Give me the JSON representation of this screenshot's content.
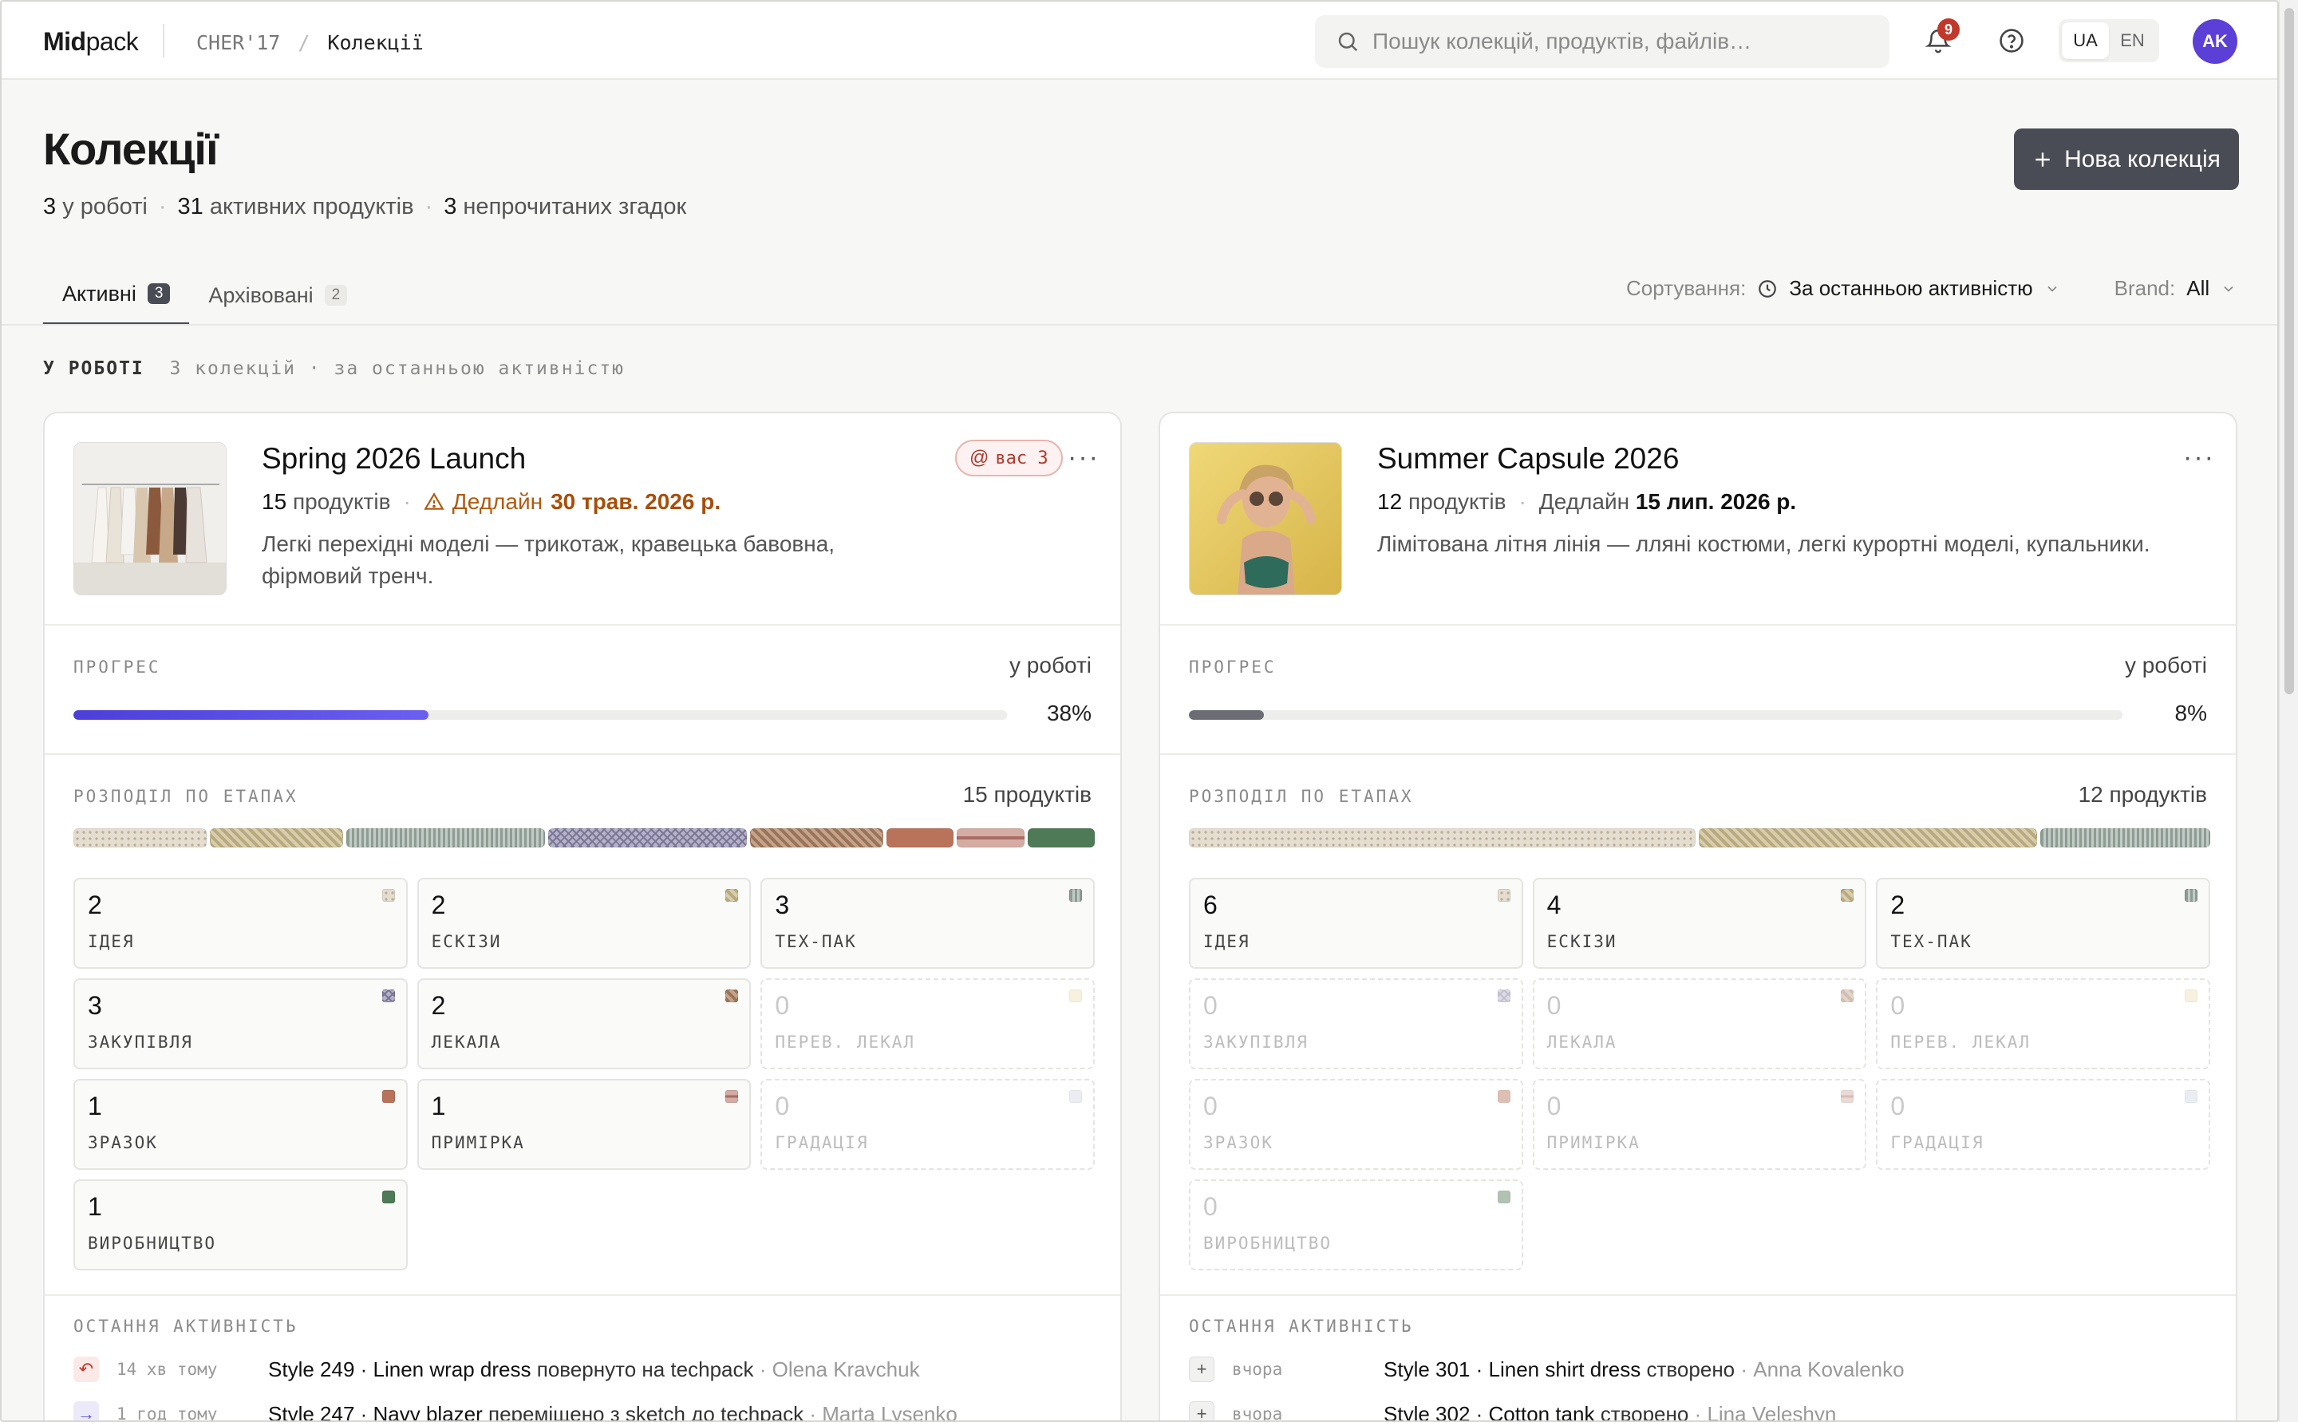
{
  "app": {
    "logo_bold": "Mid",
    "logo_light": "pack"
  },
  "breadcrumbs": [
    "CHER'17",
    "/",
    "Колекції"
  ],
  "search": {
    "placeholder": "Пошук колекцій, продуктів, файлів…"
  },
  "notifications": {
    "count": "9"
  },
  "lang": {
    "ua": "UA",
    "en": "EN"
  },
  "user": {
    "initials": "AK"
  },
  "page": {
    "title": "Колекції",
    "stats": [
      {
        "num": "3",
        "label": "у роботі"
      },
      {
        "num": "31",
        "label": "активних продуктів"
      },
      {
        "num": "3",
        "label": "непрочитаних згадок"
      }
    ],
    "new_button": "Нова колекція"
  },
  "tabs": [
    {
      "label": "Активні",
      "count": "3"
    },
    {
      "label": "Архівовані",
      "count": "2"
    }
  ],
  "sort": {
    "label": "Сортування:",
    "value": "За останньою активністю",
    "brand_label": "Brand:",
    "brand_value": "All"
  },
  "section": {
    "title": "У РОБОТІ",
    "subtitle": "3 колекцій · за останньою активністю"
  },
  "colors": {
    "accent": "#5b4fe0",
    "warn": "#a84e08",
    "button": "#4a4c55"
  },
  "cards": [
    {
      "title": "Spring 2026 Launch",
      "product_count": "15",
      "product_label": "продуктів",
      "deadline_prefix": "Дедлайн",
      "deadline": "30 трав. 2026 р.",
      "deadline_warning": true,
      "description": "Легкі перехідні моделі — трикотаж, кравецька бавовна, фірмовий тренч.",
      "mention": "вас 3",
      "progress_label": "ПРОГРЕС",
      "status": "у роботі",
      "progress": 0.38,
      "progress_text": "38%",
      "dist_label": "РОЗПОДІЛ ПО ЕТАПАХ",
      "dist_total": "15 продуктів",
      "stages": [
        {
          "count": "2",
          "name": "ІДЕЯ"
        },
        {
          "count": "2",
          "name": "ЕСКІЗИ"
        },
        {
          "count": "3",
          "name": "ТЕХ-ПАК"
        },
        {
          "count": "3",
          "name": "ЗАКУПІВЛЯ"
        },
        {
          "count": "2",
          "name": "ЛЕКАЛА"
        },
        {
          "count": "0",
          "name": "ПЕРЕВ. ЛЕКАЛ"
        },
        {
          "count": "1",
          "name": "ЗРАЗОК"
        },
        {
          "count": "1",
          "name": "ПРИМІРКА"
        },
        {
          "count": "0",
          "name": "ГРАДАЦІЯ"
        },
        {
          "count": "1",
          "name": "ВИРОБНИЦТВО"
        }
      ],
      "activity_label": "ОСТАННЯ АКТИВНІСТЬ",
      "activity": [
        {
          "icon": "undo-icon",
          "time": "14 хв тому",
          "item": "Style 249 · Linen wrap dress",
          "action": "повернуто на techpack",
          "who": "· Olena Kravchuk"
        },
        {
          "icon": "move-icon",
          "time": "1 год тому",
          "item": "Style 247 · Navy blazer",
          "action": "переміщено з sketch до techpack",
          "who": "· Marta Lysenko"
        }
      ]
    },
    {
      "title": "Summer Capsule 2026",
      "product_count": "12",
      "product_label": "продуктів",
      "deadline_prefix": "Дедлайн",
      "deadline": "15 лип. 2026 р.",
      "deadline_warning": false,
      "description": "Лімітована літня лінія — лляні костюми, легкі курортні моделі, купальники.",
      "mention": "",
      "progress_label": "ПРОГРЕС",
      "status": "у роботі",
      "progress": 0.08,
      "progress_text": "8%",
      "dist_label": "РОЗПОДІЛ ПО ЕТАПАХ",
      "dist_total": "12 продуктів",
      "stages": [
        {
          "count": "6",
          "name": "ІДЕЯ"
        },
        {
          "count": "4",
          "name": "ЕСКІЗИ"
        },
        {
          "count": "2",
          "name": "ТЕХ-ПАК"
        },
        {
          "count": "0",
          "name": "ЗАКУПІВЛЯ"
        },
        {
          "count": "0",
          "name": "ЛЕКАЛА"
        },
        {
          "count": "0",
          "name": "ПЕРЕВ. ЛЕКАЛ"
        },
        {
          "count": "0",
          "name": "ЗРАЗОК"
        },
        {
          "count": "0",
          "name": "ПРИМІРКА"
        },
        {
          "count": "0",
          "name": "ГРАДАЦІЯ"
        },
        {
          "count": "0",
          "name": "ВИРОБНИЦТВО"
        }
      ],
      "activity_label": "ОСТАННЯ АКТИВНІСТЬ",
      "activity": [
        {
          "icon": "plus-icon",
          "time": "вчора",
          "item": "Style 301 · Linen shirt dress",
          "action": "створено",
          "who": "· Anna Kovalenko"
        },
        {
          "icon": "plus-icon",
          "time": "вчора",
          "item": "Style 302 · Cotton tank",
          "action": "створено",
          "who": "· Lina Veleshyn"
        }
      ]
    }
  ]
}
